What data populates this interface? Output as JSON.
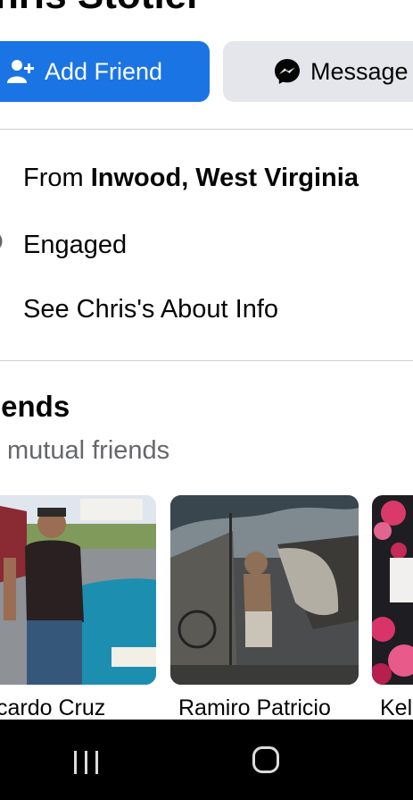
{
  "profile": {
    "name_partial": "hris Stotler"
  },
  "actions": {
    "add_friend_label": "Add Friend",
    "message_label": "Message"
  },
  "intro": {
    "from_prefix": "From ",
    "from_place": "Inwood, West Virginia",
    "relationship": "Engaged",
    "about_link": "See Chris's About Info"
  },
  "friends": {
    "title": "iends",
    "mutual": "mutual friends",
    "items": [
      {
        "name": "cardo Cruz"
      },
      {
        "name": "Ramiro Patricio"
      },
      {
        "name": "Kel"
      }
    ]
  },
  "colors": {
    "accent": "#1b74e4",
    "secondary_button": "#e4e6eb",
    "muted_text": "#65676b"
  },
  "icons": {
    "add_friend": "person-add-icon",
    "message": "messenger-icon",
    "relationship": "heart-icon",
    "nav_recent": "recent-apps-icon",
    "nav_home": "home-icon"
  }
}
